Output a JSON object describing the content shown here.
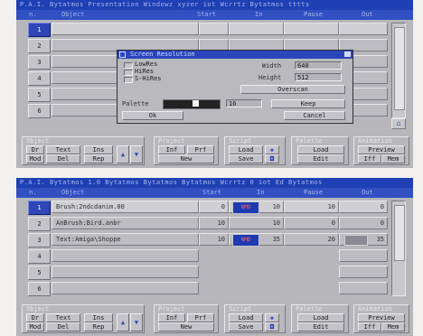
{
  "top_window": {
    "title": "P.A.I. Bytatmos Presentation Windowz xyzer iot Wcrrtz Bytatmos tttts",
    "columns": {
      "n": "n.",
      "object": "Object",
      "start": "Start",
      "in": "In",
      "pause": "Pause",
      "out": "Out"
    },
    "rows": [
      {
        "n": "1"
      },
      {
        "n": "2"
      },
      {
        "n": "3"
      },
      {
        "n": "4"
      },
      {
        "n": "5"
      },
      {
        "n": "6"
      }
    ]
  },
  "dialog": {
    "title": "Screen Resolution",
    "modes": [
      {
        "label": "LowRes",
        "selected": false
      },
      {
        "label": "HiRes",
        "selected": false
      },
      {
        "label": "S-HiRes",
        "selected": false
      }
    ],
    "width_label": "Width",
    "width_value": "640",
    "height_label": "Height",
    "height_value": "512",
    "overscan_label": "Overscan",
    "palette_label": "Palette",
    "palette_value": "16",
    "keep_label": "Keep",
    "ok_label": "Ok",
    "cancel_label": "Cancel"
  },
  "bottom_window": {
    "title": "P.A.I. Bytatmos 1.0 Bytatmos Bytatmos Bytatmos Wcrrtz 0 iot Ed Bytatmos",
    "columns": {
      "n": "n.",
      "object": "Object",
      "start": "Start",
      "in": "In",
      "pause": "Pause",
      "out": "Out"
    },
    "rows": [
      {
        "n": "1",
        "object": "Brush:2ndcdanim.00",
        "start": "0",
        "in_thumb": "NMD",
        "in": "10",
        "pause": "10",
        "out": "0"
      },
      {
        "n": "2",
        "object": "AnBrush:Bird.anbr",
        "start": "10",
        "in_thumb": "",
        "in": "10",
        "pause": "0",
        "out": "0"
      },
      {
        "n": "3",
        "object": "Text:Amiga\\Shoppe",
        "start": "10",
        "in_thumb": "NMD",
        "in": "35",
        "pause": "20",
        "out": "35"
      },
      {
        "n": "4",
        "object": "",
        "start": "",
        "in_thumb": "",
        "in": "",
        "pause": "",
        "out": ""
      },
      {
        "n": "5",
        "object": "",
        "start": "",
        "in_thumb": "",
        "in": "",
        "pause": "",
        "out": ""
      },
      {
        "n": "6",
        "object": "",
        "start": "",
        "in_thumb": "",
        "in": "",
        "pause": "",
        "out": ""
      }
    ]
  },
  "panels": {
    "object": {
      "title": "Object",
      "buttons": [
        "Dr",
        "Text",
        "Ins",
        "Mod",
        "Del",
        "Rep"
      ]
    },
    "project": {
      "title": "Project",
      "buttons": [
        "Inf",
        "Prf",
        "New"
      ]
    },
    "script": {
      "title": "Script",
      "buttons": [
        "Load",
        "Save"
      ]
    },
    "palette": {
      "title": "Palette",
      "buttons": [
        "Load",
        "Edit"
      ]
    },
    "animation": {
      "title": "Animation",
      "buttons": [
        "Preview",
        "Iff",
        "Mem"
      ]
    }
  },
  "colors": {
    "titlebar": "#1e40b4",
    "header": "#3150c2",
    "window_bg": "#b6b6bb",
    "selected_row": "#2f46b8",
    "page_bg": "#f3f1ee"
  },
  "icons": {
    "up_arrow": "up-arrow-icon",
    "down_arrow": "down-arrow-icon",
    "disk": "disk-icon",
    "scroll_up": "scroll-up-icon"
  }
}
